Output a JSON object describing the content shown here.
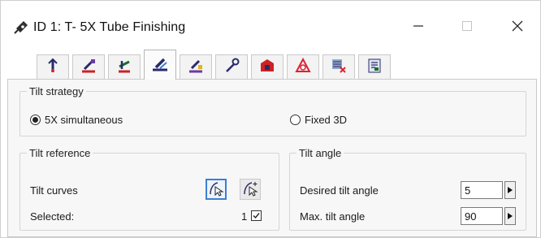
{
  "window": {
    "title": "ID 1: T- 5X Tube Finishing",
    "app_icon": "pin-icon",
    "controls": {
      "minimize": "minimize-icon",
      "maximize": "maximize-icon",
      "close": "close-icon"
    }
  },
  "tabs": [
    {
      "icon": "tool-tip-icon",
      "active": false
    },
    {
      "icon": "tool-path-icon",
      "active": false
    },
    {
      "icon": "axis-motion-icon",
      "active": false
    },
    {
      "icon": "tilt-tool-icon",
      "active": true
    },
    {
      "icon": "link-motion-icon",
      "active": false
    },
    {
      "icon": "wrench-icon",
      "active": false
    },
    {
      "icon": "part-setup-icon",
      "active": false
    },
    {
      "icon": "collision-icon",
      "active": false
    },
    {
      "icon": "roughing-icon",
      "active": false
    },
    {
      "icon": "report-icon",
      "active": false
    }
  ],
  "tilt_strategy": {
    "title": "Tilt strategy",
    "options": [
      {
        "label": "5X simultaneous",
        "selected": true
      },
      {
        "label": "Fixed 3D",
        "selected": false
      }
    ]
  },
  "tilt_reference": {
    "title": "Tilt reference",
    "tilt_curves_label": "Tilt curves",
    "selected_label": "Selected:",
    "selected_count": "1",
    "selected_checked": true
  },
  "tilt_angle": {
    "title": "Tilt angle",
    "desired_label": "Desired tilt angle",
    "desired_value": "5",
    "max_label": "Max. tilt angle",
    "max_value": "90"
  },
  "colors": {
    "accent": "#3b7fd4",
    "tab_active": "#fbfbfb",
    "panel_bg": "#f7f7f7"
  }
}
